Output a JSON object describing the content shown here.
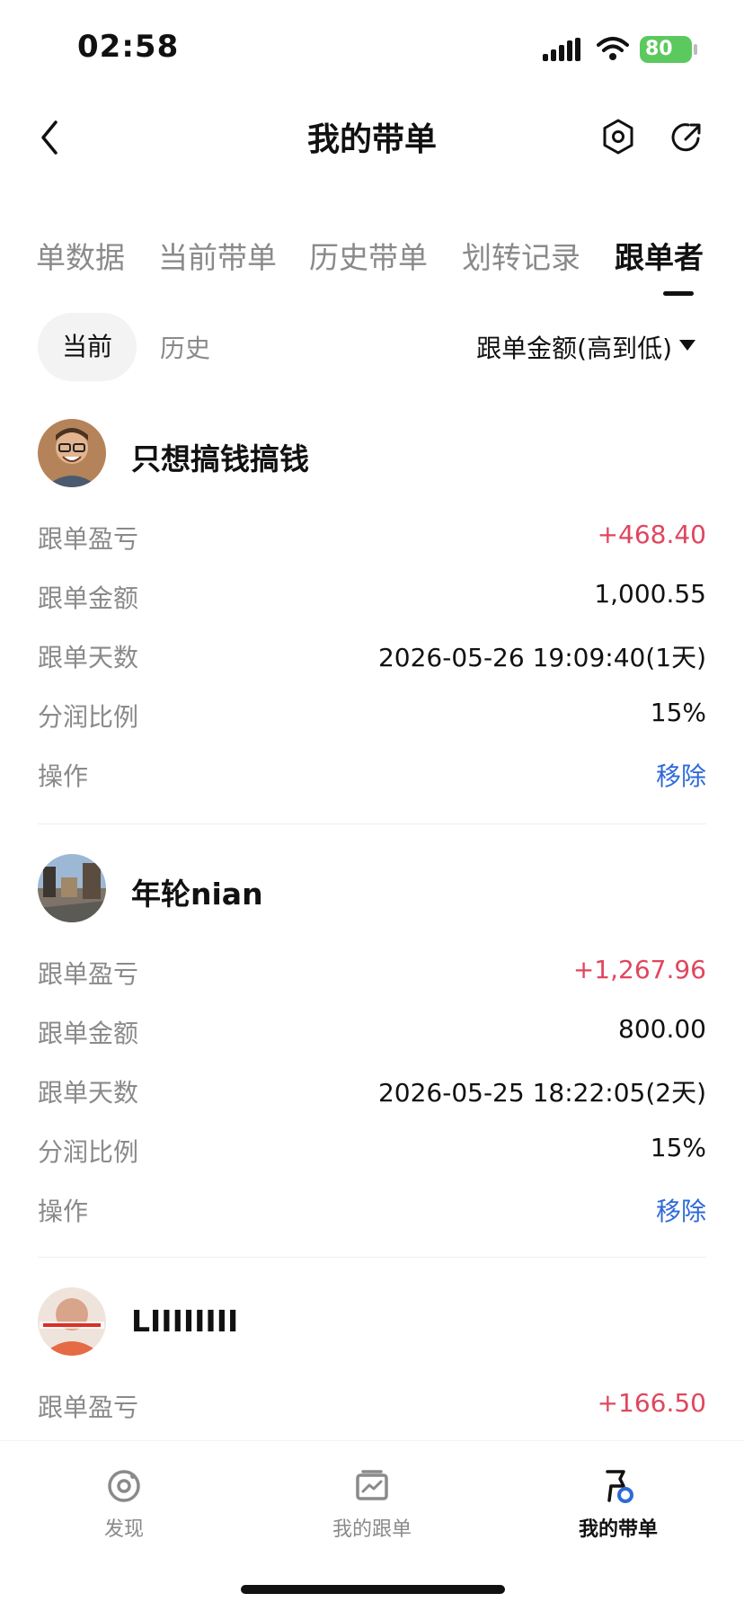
{
  "status": {
    "time": "02:58",
    "battery": "80"
  },
  "header": {
    "title": "我的带单"
  },
  "tabs": [
    "单数据",
    "当前带单",
    "历史带单",
    "划转记录",
    "跟单者"
  ],
  "subtabs": {
    "current": "当前",
    "history": "历史",
    "sort": "跟单金额(高到低)"
  },
  "followers": [
    {
      "name": "只想搞钱搞钱",
      "rows": [
        {
          "label": "跟单盈亏",
          "value": "+468.40"
        },
        {
          "label": "跟单金额",
          "value": "1,000.55"
        },
        {
          "label": "跟单天数",
          "value": "2026-05-26 19:09:40(1天)"
        },
        {
          "label": "分润比例",
          "value": "15%"
        },
        {
          "label": "操作",
          "value": "移除"
        }
      ]
    },
    {
      "name": "年轮nian",
      "rows": [
        {
          "label": "跟单盈亏",
          "value": "+1,267.96"
        },
        {
          "label": "跟单金额",
          "value": "800.00"
        },
        {
          "label": "跟单天数",
          "value": "2026-05-25 18:22:05(2天)"
        },
        {
          "label": "分润比例",
          "value": "15%"
        },
        {
          "label": "操作",
          "value": "移除"
        }
      ]
    },
    {
      "name": "LIIIIIIII",
      "rows": [
        {
          "label": "跟单盈亏",
          "value": "+166.50"
        }
      ]
    }
  ],
  "bottom_nav": [
    {
      "label": "发现",
      "icon": "discover-icon"
    },
    {
      "label": "我的跟单",
      "icon": "chart-board-icon"
    },
    {
      "label": "我的带单",
      "icon": "flag-badge-icon"
    }
  ],
  "colors": {
    "profit": "#e0465e",
    "action": "#2e6ad8",
    "battery": "#5cc95e"
  }
}
